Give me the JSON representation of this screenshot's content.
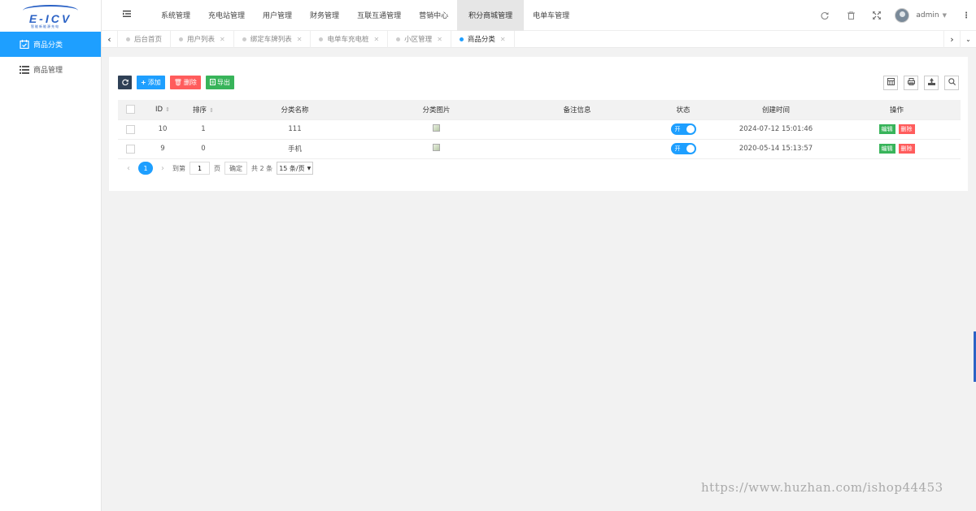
{
  "logo": {
    "text": "E-ICV",
    "subtitle": "智能新能源充电"
  },
  "sidebar": {
    "items": [
      {
        "label": "商品分类",
        "icon": "calendar-check-icon",
        "active": true
      },
      {
        "label": "商品管理",
        "icon": "list-icon",
        "active": false
      }
    ]
  },
  "header": {
    "nav": [
      {
        "label": "系统管理"
      },
      {
        "label": "充电站管理"
      },
      {
        "label": "用户管理"
      },
      {
        "label": "财务管理"
      },
      {
        "label": "互联互通管理"
      },
      {
        "label": "营销中心"
      },
      {
        "label": "积分商城管理",
        "active": true
      },
      {
        "label": "电单车管理"
      }
    ],
    "username": "admin"
  },
  "tabs": [
    {
      "label": "后台首页",
      "closable": false
    },
    {
      "label": "用户列表",
      "closable": true
    },
    {
      "label": "绑定车牌列表",
      "closable": true
    },
    {
      "label": "电单车充电桩",
      "closable": true
    },
    {
      "label": "小区管理",
      "closable": true
    },
    {
      "label": "商品分类",
      "closable": true,
      "active": true
    }
  ],
  "toolbar": {
    "add": "添加",
    "delete": "删除",
    "export": "导出"
  },
  "table": {
    "columns": [
      "ID",
      "排序",
      "分类名称",
      "分类图片",
      "备注信息",
      "状态",
      "创建时间",
      "操作"
    ],
    "rows": [
      {
        "id": "10",
        "sort": "1",
        "name": "111",
        "remark": "",
        "status": "开",
        "created": "2024-07-12 15:01:46",
        "edit": "编辑",
        "del": "删除"
      },
      {
        "id": "9",
        "sort": "0",
        "name": "手机",
        "remark": "",
        "status": "开",
        "created": "2020-05-14 15:13:57",
        "edit": "编辑",
        "del": "删除"
      }
    ]
  },
  "pager": {
    "current": "1",
    "goto_label": "到第",
    "page_value": "1",
    "page_unit": "页",
    "confirm": "确定",
    "total": "共 2 条",
    "per_page": "15 条/页"
  },
  "watermark": "https://www.huzhan.com/ishop44453",
  "colors": {
    "accent": "#1e9fff",
    "danger": "#ff5c5c",
    "success": "#38b45a",
    "dark": "#2f4056"
  }
}
